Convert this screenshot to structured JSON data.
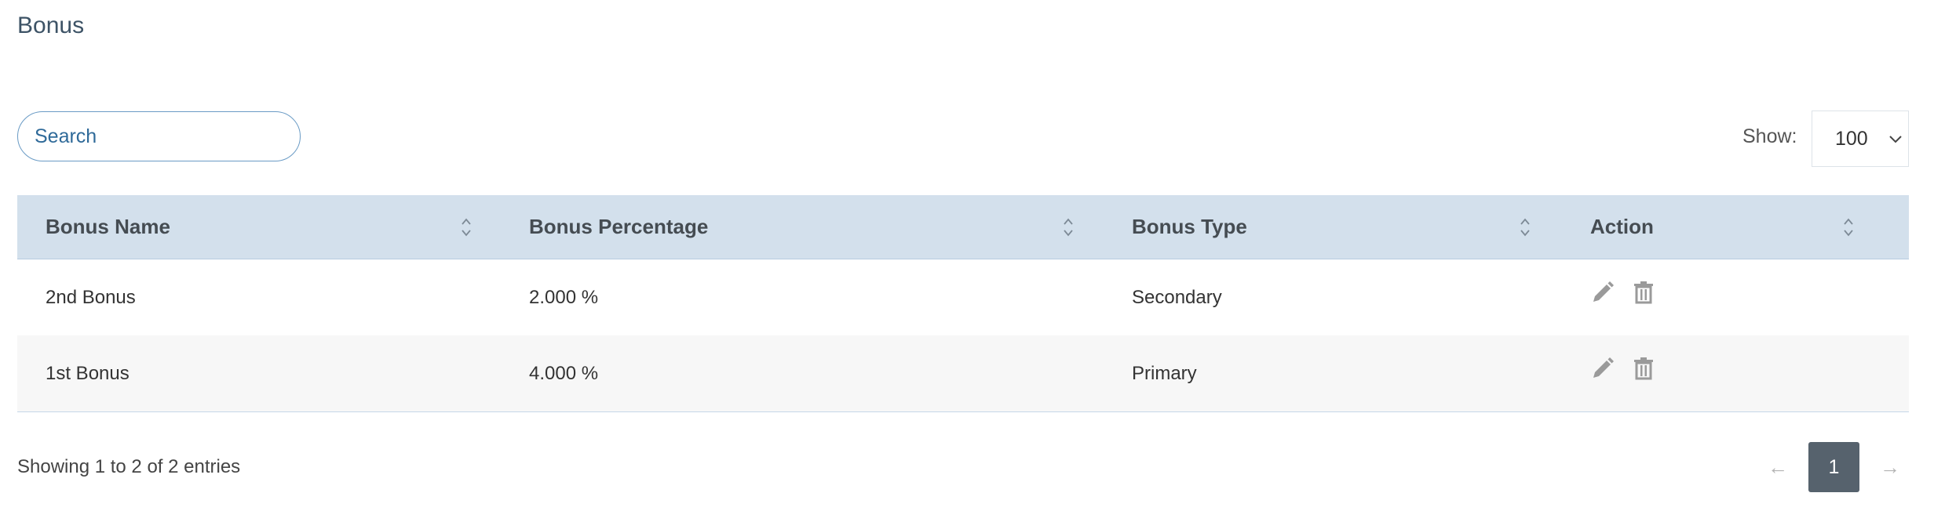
{
  "page": {
    "title": "Bonus"
  },
  "search": {
    "placeholder": "Search",
    "value": ""
  },
  "show": {
    "label": "Show:",
    "value": "100"
  },
  "table": {
    "columns": [
      "Bonus Name",
      "Bonus Percentage",
      "Bonus Type",
      "Action"
    ],
    "rows": [
      {
        "name": "2nd Bonus",
        "percentage": "2.000 %",
        "type": "Secondary"
      },
      {
        "name": "1st Bonus",
        "percentage": "4.000 %",
        "type": "Primary"
      }
    ]
  },
  "footer": {
    "info": "Showing 1 to 2 of 2 entries",
    "prev": "←",
    "page": "1",
    "next": "→"
  },
  "colors": {
    "header_bg": "#d3e0ec",
    "accent": "#2f6a99",
    "active_page": "#56626d"
  }
}
